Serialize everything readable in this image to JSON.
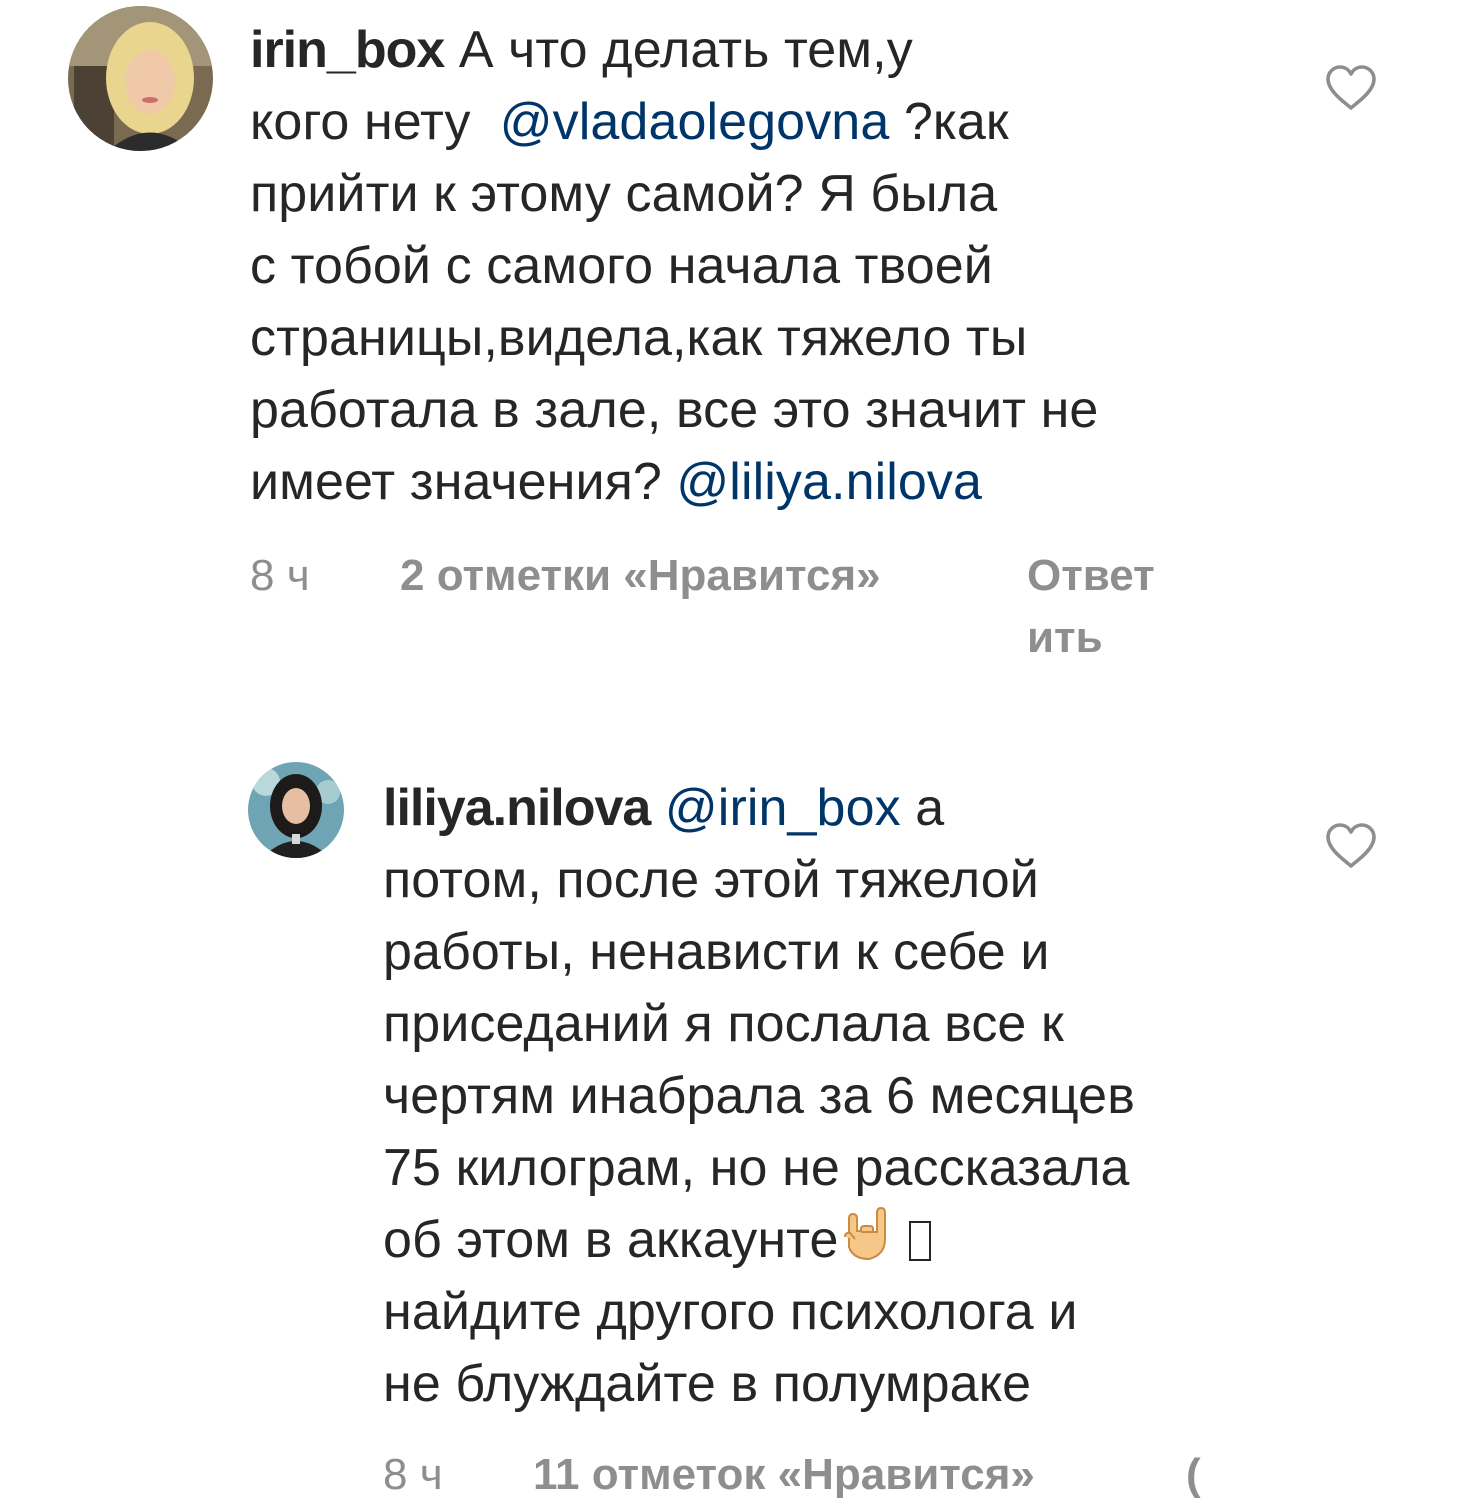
{
  "comments": [
    {
      "username": "irin_box",
      "lines": [
        [
          {
            "t": "А что делать тем,у",
            "type": "text"
          }
        ],
        [
          {
            "t": "кого нету  ",
            "type": "text"
          },
          {
            "t": "@vladaolegovna",
            "type": "mention"
          },
          {
            "t": " ?как",
            "type": "text"
          }
        ],
        [
          {
            "t": "прийти к этому самой? Я была",
            "type": "text"
          }
        ],
        [
          {
            "t": "с тобой с самого начала твоей",
            "type": "text"
          }
        ],
        [
          {
            "t": "страницы,видела,как тяжело ты",
            "type": "text"
          }
        ],
        [
          {
            "t": "работала в зале, все это значит не",
            "type": "text"
          }
        ],
        [
          {
            "t": "имеет значения? ",
            "type": "text"
          },
          {
            "t": "@liliya.nilova",
            "type": "mention"
          }
        ]
      ],
      "time": "8 ч",
      "likes": "2 отметки «Нравится»",
      "reply": [
        "Ответ",
        "ить"
      ]
    },
    {
      "username": "liliya.nilova",
      "lines": [
        [
          {
            "t": "@irin_box",
            "type": "mention"
          },
          {
            "t": " а",
            "type": "text"
          }
        ],
        [
          {
            "t": "потом, после этой тяжелой",
            "type": "text"
          }
        ],
        [
          {
            "t": "работы, ненависти к себе и",
            "type": "text"
          }
        ],
        [
          {
            "t": "приседаний я послала все к",
            "type": "text"
          }
        ],
        [
          {
            "t": "чертям инабрала за 6 месяцев",
            "type": "text"
          }
        ],
        [
          {
            "t": "75 килограм, но не рассказала",
            "type": "text"
          }
        ],
        [
          {
            "t": "об этом в аккаунте",
            "type": "text"
          }
        ],
        [
          {
            "t": "найдите другого психолога и",
            "type": "text"
          }
        ],
        [
          {
            "t": "не блуждайте в полумраке",
            "type": "text"
          }
        ]
      ],
      "time": "8 ч",
      "likes": "11 отметок «Нравится»",
      "reply": [
        "("
      ]
    }
  ],
  "icons": {
    "like": "heart-outline-icon",
    "emoji": "sign-of-the-horns-emoji"
  },
  "colors": {
    "text": "#262626",
    "mention": "#003569",
    "meta": "#8e8e8e"
  }
}
